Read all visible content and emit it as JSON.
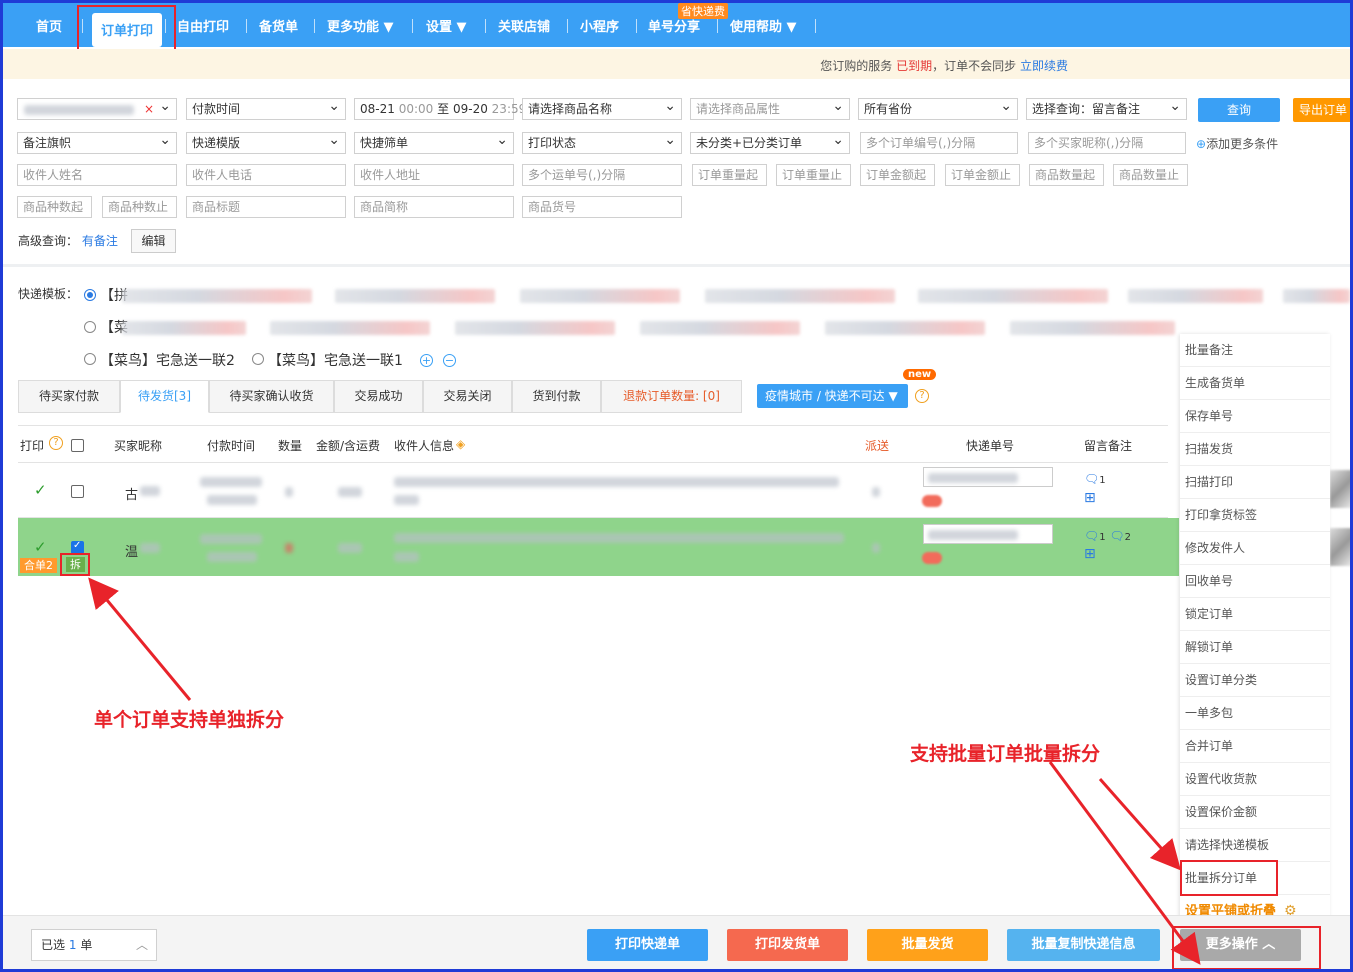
{
  "nav": {
    "items": [
      {
        "label": "首页"
      },
      {
        "label": "订单打印"
      },
      {
        "label": "自由打印"
      },
      {
        "label": "备货单"
      },
      {
        "label": "更多功能 ▼"
      },
      {
        "label": "设置 ▼"
      },
      {
        "label": "关联店铺"
      },
      {
        "label": "小程序"
      },
      {
        "label": "单号分享"
      },
      {
        "label": "使用帮助 ▼"
      }
    ],
    "badge": "省快递费"
  },
  "notice": {
    "prefix": "您订购的服务",
    "status": "已到期",
    "middle": "，订单不会同步",
    "link": "立即续费"
  },
  "filters": {
    "row1": {
      "pay_time": "付款时间",
      "date_from": "08-21",
      "time_from": "00:00",
      "to": "至",
      "date_to": "09-20",
      "time_to": "23:59",
      "product_name": "请选择商品名称",
      "product_attr": "请选择商品属性",
      "province": "所有省份",
      "query_select": "选择查询：留言备注",
      "query_btn": "查询",
      "export_btn": "导出订单"
    },
    "row2": {
      "remark_flag": "备注旗帜",
      "express_template": "快递模版",
      "quick_filter": "快捷筛单",
      "print_status": "打印状态",
      "category": "未分类+已分类订单",
      "order_ids_ph": "多个订单编号(,)分隔",
      "buyer_nick_ph": "多个买家昵称(,)分隔",
      "add_more": "添加更多条件"
    },
    "row3": {
      "recv_name": "收件人姓名",
      "recv_phone": "收件人电话",
      "recv_addr": "收件人地址",
      "waybill_ph": "多个运单号(,)分隔",
      "weight_from": "订单重量起",
      "weight_to": "订单重量止",
      "amount_from": "订单金额起",
      "amount_to": "订单金额止",
      "qty_from": "商品数量起",
      "qty_to": "商品数量止"
    },
    "row4": {
      "kinds_from": "商品种数起",
      "kinds_to": "商品种数止",
      "title": "商品标题",
      "short_name": "商品简称",
      "sku_code": "商品货号"
    },
    "advanced": {
      "label": "高级查询：",
      "value": "有备注",
      "edit": "编辑"
    }
  },
  "templates": {
    "label": "快递模板：",
    "first_prefix": "【拼",
    "second_prefix": "【菜",
    "item3": "【菜鸟】宅急送一联2",
    "item4": "【菜鸟】宅急送一联1"
  },
  "tabs": [
    {
      "label": "待买家付款"
    },
    {
      "label": "待发货[3]"
    },
    {
      "label": "待买家确认收货"
    },
    {
      "label": "交易成功"
    },
    {
      "label": "交易关闭"
    },
    {
      "label": "货到付款"
    },
    {
      "label": "退款订单数量:  [0]"
    }
  ],
  "city_btn": "疫情城市 / 快递不可达 ▼",
  "new_badge": "new",
  "table": {
    "headers": {
      "print": "打印",
      "buyer": "买家昵称",
      "pay_time": "付款时间",
      "qty": "数量",
      "amount": "金额/含运费",
      "receiver": "收件人信息",
      "dispatch": "派送",
      "waybill": "快递单号",
      "remark": "留言备注"
    },
    "rows": [
      {
        "buyer_initial": "古",
        "remark_count": "1"
      },
      {
        "buyer_initial": "温",
        "remark_count": "1",
        "remark_count2": "2",
        "tag_merge": "合单2",
        "tag_split": "拆"
      }
    ]
  },
  "annotations": {
    "single": "单个订单支持单独拆分",
    "batch": "支持批量订单批量拆分"
  },
  "menu": {
    "items": [
      "批量备注",
      "生成备货单",
      "保存单号",
      "扫描发货",
      "扫描打印",
      "打印拿货标签",
      "修改发件人",
      "回收单号",
      "锁定订单",
      "解锁订单",
      "设置订单分类",
      "一单多包",
      "合并订单",
      "设置代收货款",
      "设置保价金额",
      "请选择快递模板",
      "批量拆分订单",
      "设置平铺或折叠"
    ]
  },
  "footer": {
    "selected_prefix": "已选",
    "selected_count": "1",
    "selected_suffix": "单",
    "btn_print_express": "打印快递单",
    "btn_print_ship": "打印发货单",
    "btn_batch_ship": "批量发货",
    "btn_copy_info": "批量复制快递信息",
    "btn_more": "更多操作 ︿"
  },
  "colors": {
    "nav_bg": "#3aa0f5",
    "highlight_row": "#8fd48b",
    "annotation_red": "#e8232a"
  }
}
